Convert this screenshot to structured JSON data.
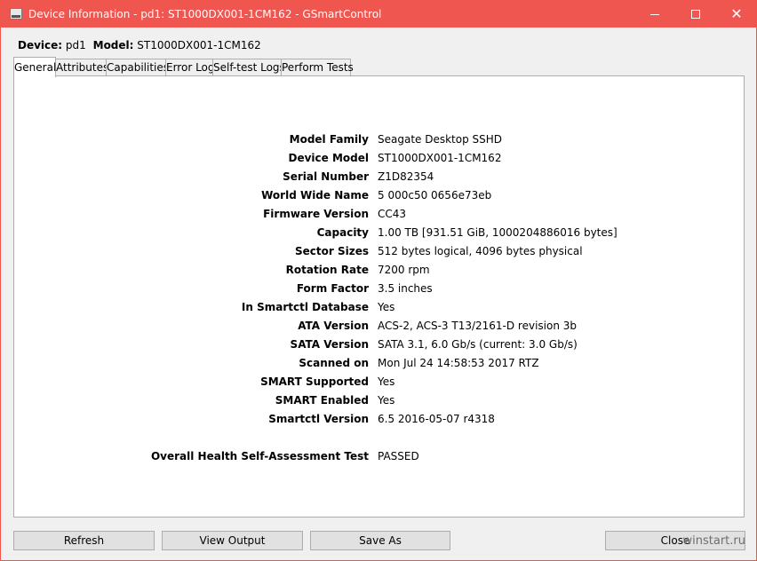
{
  "window": {
    "title": "Device Information - pd1: ST1000DX001-1CM162 - GSmartControl",
    "close_glyph": "✕"
  },
  "header": {
    "device_label": "Device:",
    "device_value": "pd1",
    "model_label": "Model:",
    "model_value": "ST1000DX001-1CM162"
  },
  "tabs": [
    {
      "label": "General"
    },
    {
      "label": "Attributes"
    },
    {
      "label": "Capabilities"
    },
    {
      "label": "Error Log"
    },
    {
      "label": "Self-test Logs"
    },
    {
      "label": "Perform Tests"
    }
  ],
  "info": [
    {
      "key": "Model Family",
      "value": "Seagate Desktop SSHD"
    },
    {
      "key": "Device Model",
      "value": "ST1000DX001-1CM162"
    },
    {
      "key": "Serial Number",
      "value": "Z1D82354"
    },
    {
      "key": "World Wide Name",
      "value": "5 000c50 0656e73eb"
    },
    {
      "key": "Firmware Version",
      "value": "CC43"
    },
    {
      "key": "Capacity",
      "value": "1.00 TB [931.51 GiB, 1000204886016 bytes]"
    },
    {
      "key": "Sector Sizes",
      "value": "512 bytes logical, 4096 bytes physical"
    },
    {
      "key": "Rotation Rate",
      "value": "7200 rpm"
    },
    {
      "key": "Form Factor",
      "value": "3.5 inches"
    },
    {
      "key": "In Smartctl Database",
      "value": "Yes"
    },
    {
      "key": "ATA Version",
      "value": "ACS-2, ACS-3 T13/2161-D revision 3b"
    },
    {
      "key": "SATA Version",
      "value": "SATA 3.1, 6.0 Gb/s (current: 3.0 Gb/s)"
    },
    {
      "key": "Scanned on",
      "value": "Mon Jul 24 14:58:53 2017 RTZ"
    },
    {
      "key": "SMART Supported",
      "value": "Yes"
    },
    {
      "key": "SMART Enabled",
      "value": "Yes"
    },
    {
      "key": "Smartctl Version",
      "value": "6.5 2016-05-07 r4318"
    }
  ],
  "health": {
    "key": "Overall Health Self-Assessment Test",
    "value": "PASSED"
  },
  "buttons": {
    "refresh": "Refresh",
    "view_output": "View Output",
    "save_as": "Save As",
    "close": "Close"
  },
  "watermark": "winstart.ru"
}
